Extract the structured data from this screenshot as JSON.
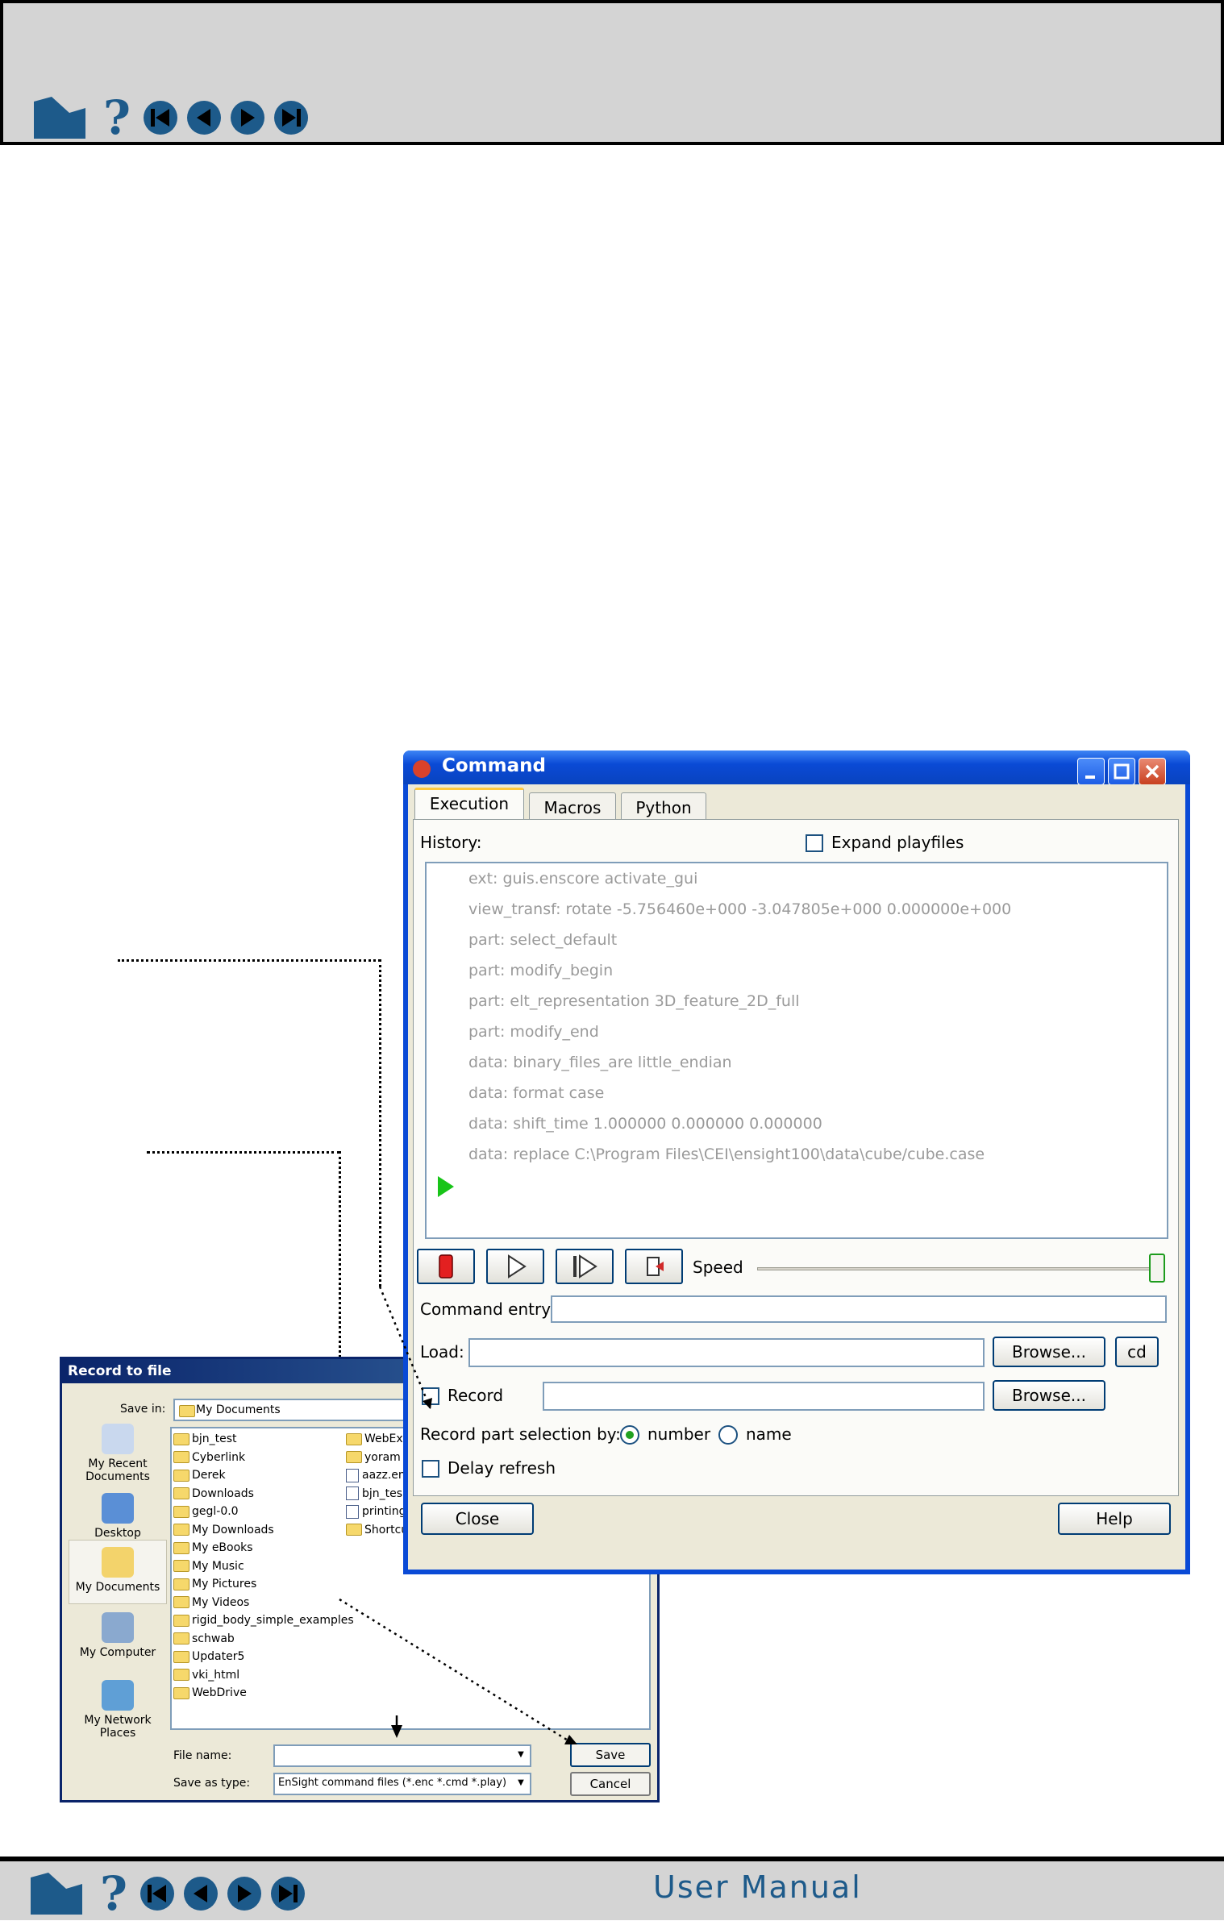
{
  "manual": {
    "title": "User Manual",
    "nav_icons": [
      "home-icon",
      "help-icon",
      "first-page-icon",
      "previous-page-icon",
      "next-page-icon",
      "last-page-icon"
    ]
  },
  "record_dialog": {
    "title": "Record to file",
    "save_in_label": "Save in:",
    "save_in_value": "My Documents",
    "places": [
      "My Recent Documents",
      "Desktop",
      "My Documents",
      "My Computer",
      "My Network Places"
    ],
    "files_col1": [
      "bjn_test",
      "Cyberlink",
      "Derek",
      "Downloads",
      "gegl-0.0",
      "My Downloads",
      "My eBooks",
      "My Music",
      "My Pictures",
      "My Videos",
      "rigid_body_simple_examples",
      "schwab",
      "Updater5",
      "vki_html",
      "WebDrive"
    ],
    "files_col2": [
      "WebEx",
      "yoram",
      "aazz.en",
      "bjn_tes",
      "printing",
      "Shortcu"
    ],
    "file_name_label": "File name:",
    "file_name_value": "",
    "save_type_label": "Save as type:",
    "save_type_value": "EnSight command files (*.enc *.cmd *.play)",
    "save_button": "Save",
    "cancel_button": "Cancel"
  },
  "command_window": {
    "title": "Command",
    "tabs": [
      "Execution",
      "Macros",
      "Python"
    ],
    "active_tab": "Execution",
    "history_label": "History:",
    "expand_playfiles_label": "Expand playfiles",
    "history": [
      "ext: guis.enscore activate_gui",
      "view_transf: rotate -5.756460e+000 -3.047805e+000 0.000000e+000",
      "part: select_default",
      "part: modify_begin",
      "part: elt_representation 3D_feature_2D_full",
      "part: modify_end",
      "data: binary_files_are little_endian",
      "data: format case",
      "data: shift_time 1.000000 0.000000 0.000000",
      "data: replace C:\\Program Files\\CEI\\ensight100\\data\\cube/cube.case"
    ],
    "speed_label": "Speed",
    "speed_value": 1.0,
    "command_entry_label": "Command entry:",
    "command_entry_value": "",
    "load_label": "Load:",
    "load_value": "",
    "browse_label": "Browse...",
    "cd_label": "cd",
    "record_label": "Record",
    "record_value": "",
    "record_part_label": "Record part selection by:",
    "option_number": "number",
    "option_name": "name",
    "selected_option": "number",
    "delay_refresh_label": "Delay refresh",
    "close_button": "Close",
    "help_button": "Help"
  }
}
